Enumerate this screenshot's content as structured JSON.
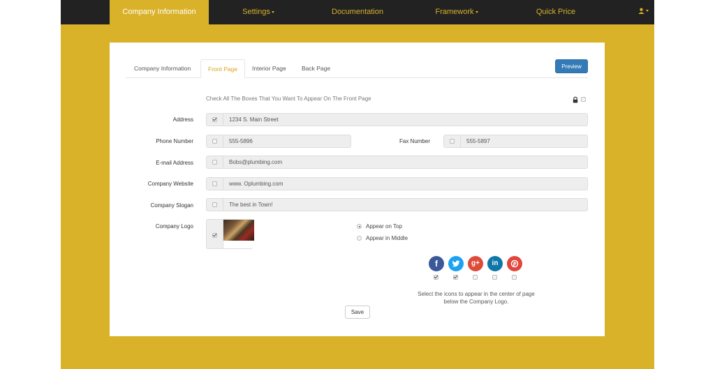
{
  "nav": {
    "items": [
      {
        "label": "Company Information",
        "active": true
      },
      {
        "label": "Settings",
        "dropdown": true
      },
      {
        "label": "Documentation"
      },
      {
        "label": "Framework",
        "dropdown": true
      },
      {
        "label": "Quick Price"
      }
    ],
    "user_icon": "user-icon"
  },
  "tabs": [
    {
      "label": "Company Information"
    },
    {
      "label": "Front Page",
      "active": true
    },
    {
      "label": "Interior Page"
    },
    {
      "label": "Back Page"
    }
  ],
  "preview_label": "Preview",
  "instruction": "Check All The Boxes That You Want To Appear On The Front Page",
  "lock_checked": false,
  "fields": {
    "address": {
      "label": "Address",
      "value": "1234 S. Main Street",
      "checked": true
    },
    "phone": {
      "label": "Phone Number",
      "value": "555-5896",
      "checked": false
    },
    "fax": {
      "label": "Fax Number",
      "value": "555-5897",
      "checked": false
    },
    "email": {
      "label": "E-mail Address",
      "value": "Bobs@plumbing.com",
      "checked": false
    },
    "website": {
      "label": "Company Website",
      "value": "www. Oplumbing.com",
      "checked": false
    },
    "slogan": {
      "label": "Company Slogan",
      "value": "The best in Town!",
      "checked": false
    },
    "logo": {
      "label": "Company Logo",
      "checked": true
    }
  },
  "logo_position": {
    "options": [
      "Appear on Top",
      "Appear in Middle"
    ],
    "selected": "Appear on Top"
  },
  "social": [
    {
      "name": "facebook",
      "glyph": "f",
      "color": "#3b5998",
      "checked": true
    },
    {
      "name": "twitter",
      "glyph": "t",
      "color": "#1da1f2",
      "checked": true
    },
    {
      "name": "google-plus",
      "glyph": "g+",
      "color": "#dd4b39",
      "checked": false
    },
    {
      "name": "linkedin",
      "glyph": "in",
      "color": "#0e76a8",
      "checked": false
    },
    {
      "name": "pinterest",
      "glyph": "p",
      "color": "#e0463a",
      "checked": false
    }
  ],
  "social_note_line1": "Select the icons to appear in the center of page",
  "social_note_line2": "below the Company Logo.",
  "save_label": "Save"
}
